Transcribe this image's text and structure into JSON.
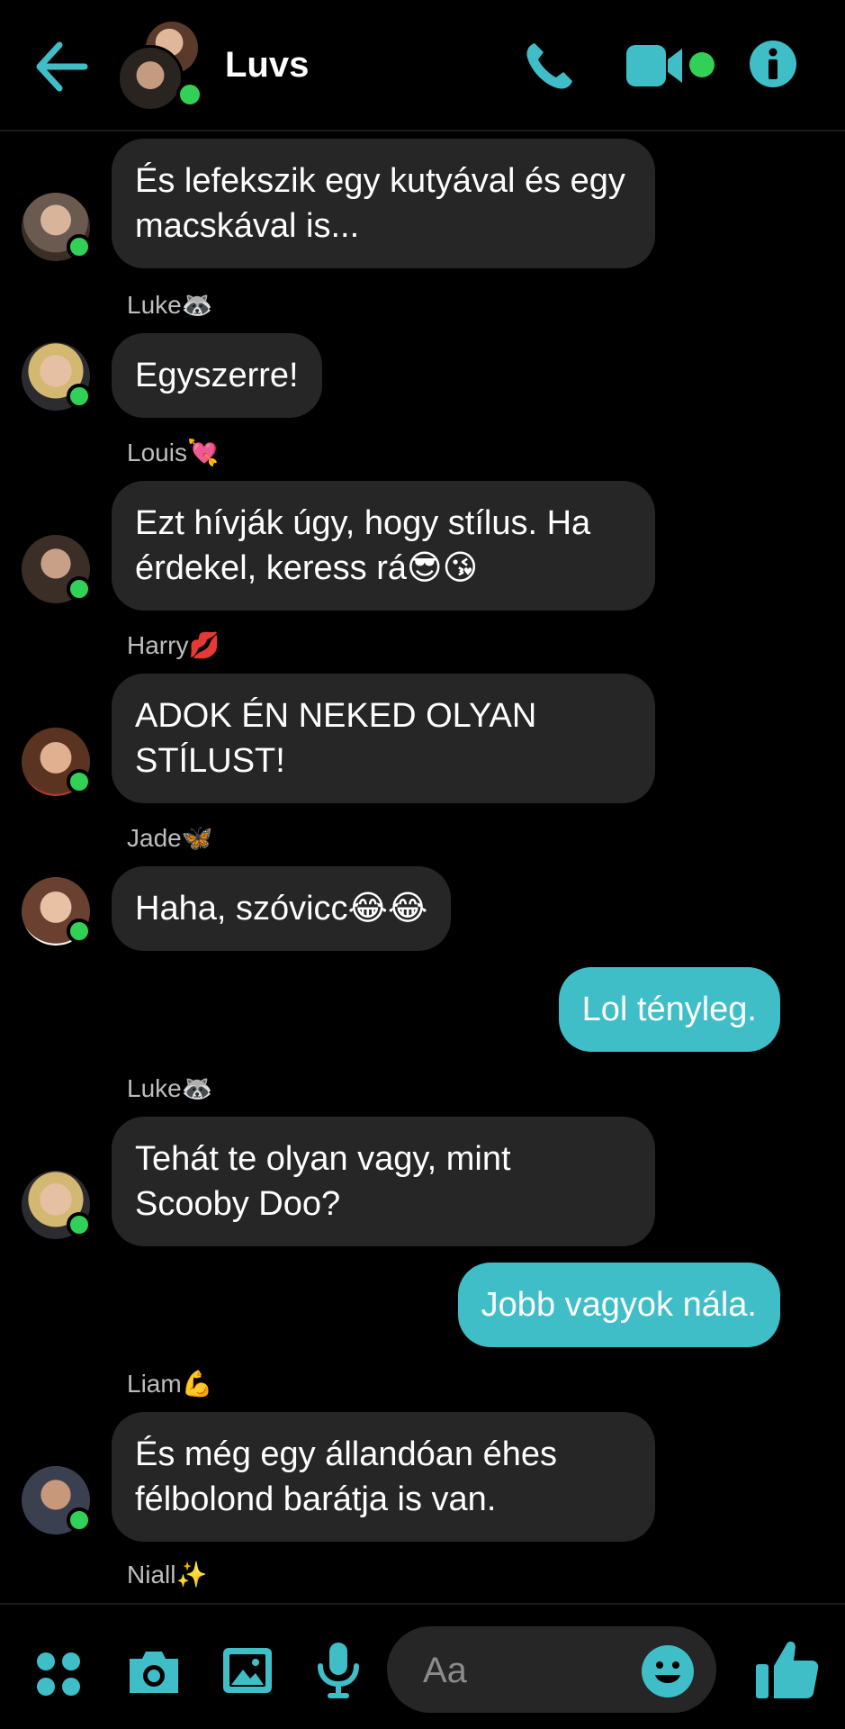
{
  "header": {
    "title": "Luvs"
  },
  "messages": [
    {
      "text": "És lefekszik egy kutyával és egy macskával is..."
    },
    {
      "sender": "Luke🦝",
      "text": "Egyszerre!"
    },
    {
      "sender": "Louis💘",
      "text": "Ezt hívják úgy, hogy stílus. Ha érdekel, keress rá😎😘"
    },
    {
      "sender": "Harry💋",
      "text": "ADOK ÉN NEKED OLYAN STÍLUST!"
    },
    {
      "sender": "Jade🦋",
      "text": "Haha, szóvicc😂😂"
    },
    {
      "text": "Lol tényleg."
    },
    {
      "sender": "Luke🦝",
      "text": "Tehát te olyan vagy, mint Scooby Doo?"
    },
    {
      "text": "Jobb vagyok nála."
    },
    {
      "sender": "Liam💪",
      "text": "És még egy állandóan éhes félbolond barátja is van."
    },
    {
      "sender": "Niall✨"
    }
  ],
  "composer": {
    "placeholder": "Aa"
  },
  "colors": {
    "accent": "#3fbec8",
    "online": "#31d158",
    "bubble": "#262626"
  },
  "icons": [
    "back-arrow-icon",
    "phone-icon",
    "video-camera-icon",
    "info-icon",
    "apps-icon",
    "camera-icon",
    "gallery-icon",
    "microphone-icon",
    "emoji-icon",
    "thumbs-up-icon"
  ]
}
